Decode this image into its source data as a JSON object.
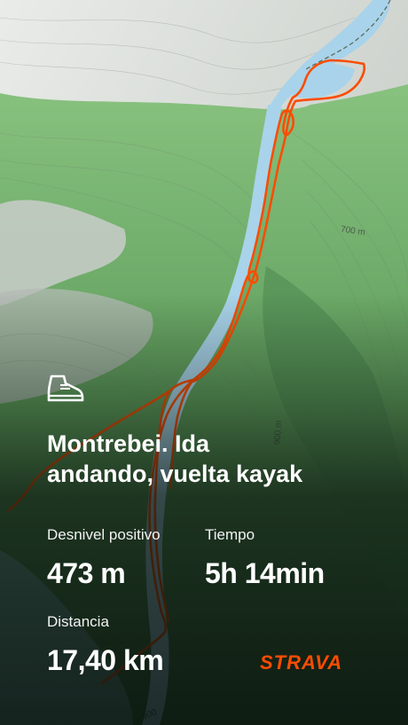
{
  "activity": {
    "icon": "hiking-boot-icon",
    "title_line1": "Montrebei. Ida",
    "title_line2": "andando, vuelta kayak"
  },
  "stats": {
    "elevation_label": "Desnivel positivo",
    "elevation_value": "473 m",
    "time_label": "Tiempo",
    "time_value": "5h 14min",
    "distance_label": "Distancia",
    "distance_value": "17,40 km"
  },
  "map": {
    "contour_label_1": "700 m",
    "contour_label_2": "900 m",
    "contour_label_3": "900",
    "route_color": "#fc4c02",
    "water_color": "#a9d3ea",
    "forest_color": "#6fae6a"
  },
  "brand": {
    "name": "STRAVA",
    "color": "#fc4c02"
  }
}
